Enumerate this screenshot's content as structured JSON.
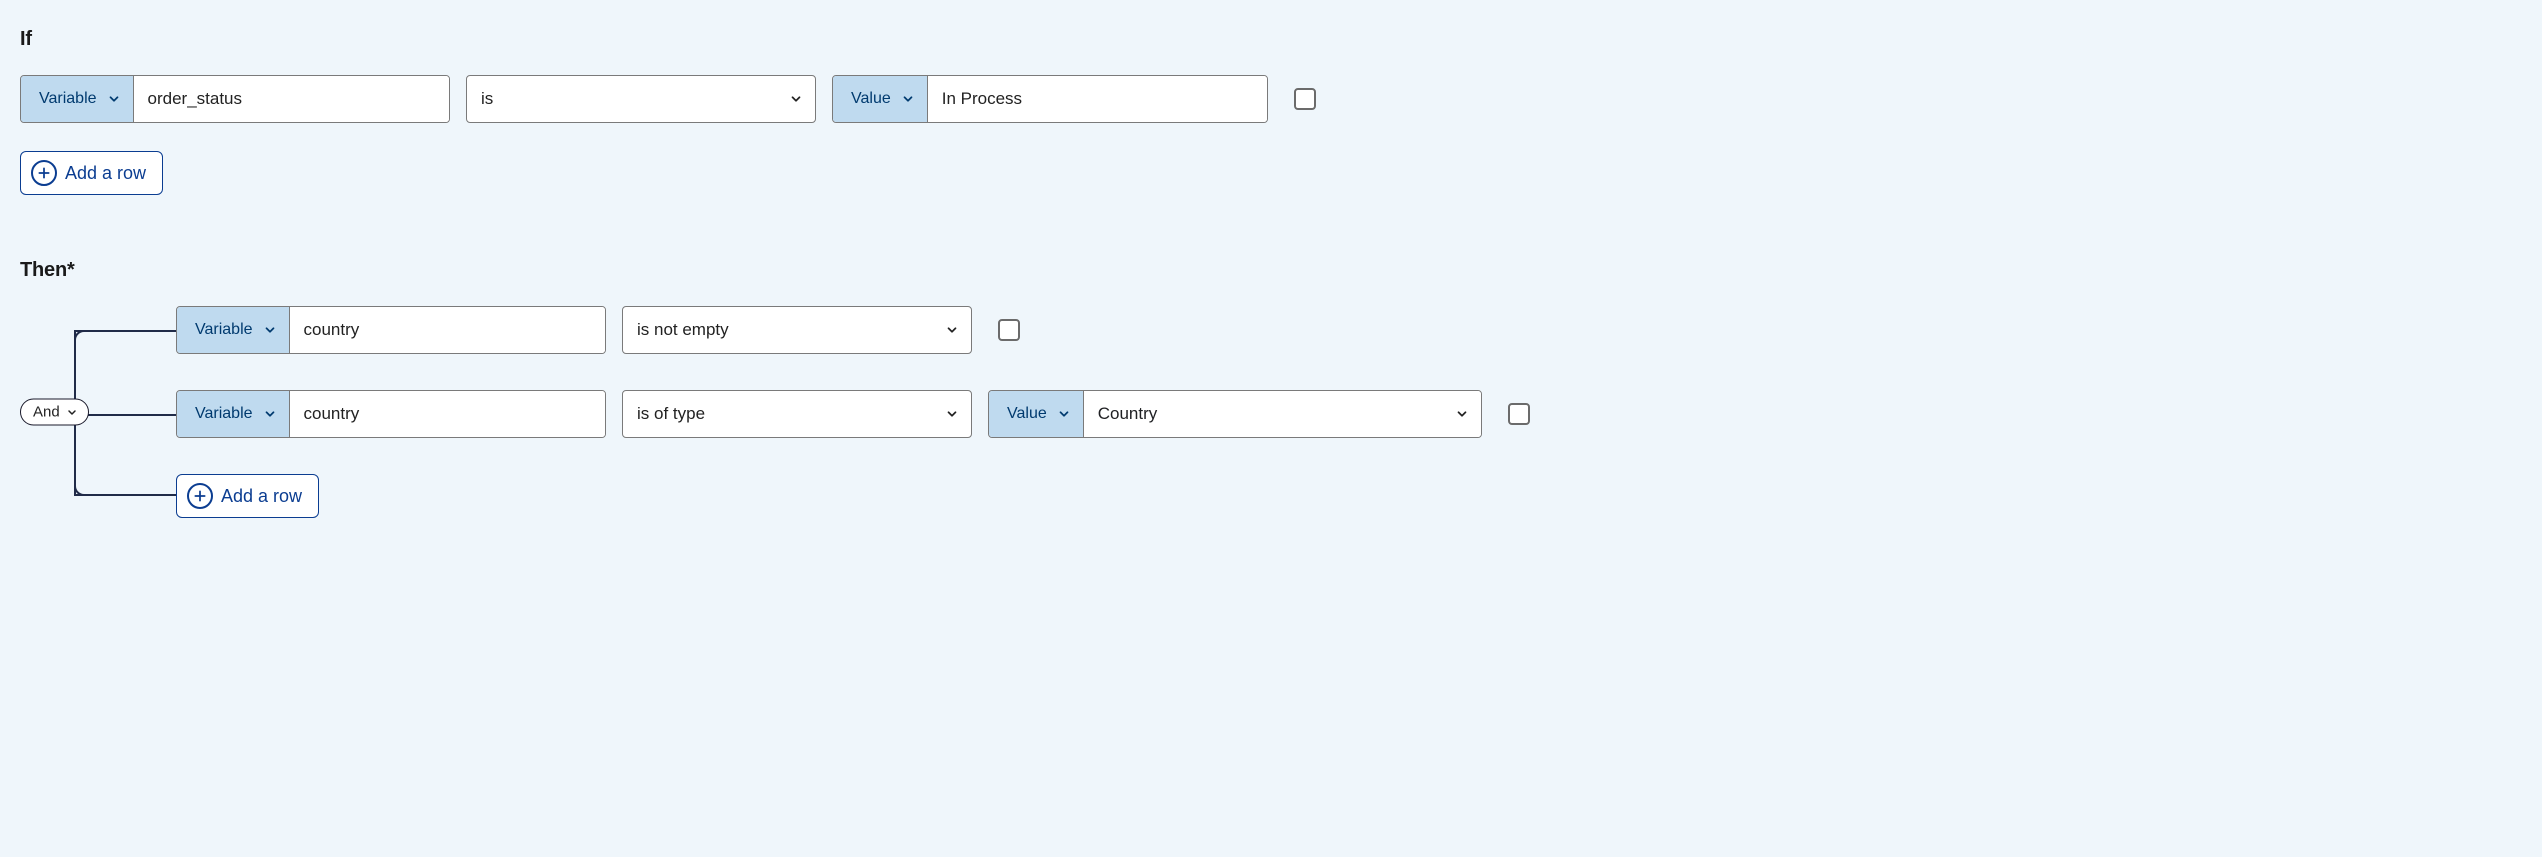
{
  "if": {
    "heading": "If",
    "row": {
      "type_label": "Variable",
      "variable": "order_status",
      "operator": "is",
      "value_type_label": "Value",
      "value": "In Process"
    },
    "add_row_label": "Add a row"
  },
  "then": {
    "heading": "Then*",
    "logic": "And",
    "rows": [
      {
        "type_label": "Variable",
        "variable": "country",
        "operator": "is not empty"
      },
      {
        "type_label": "Variable",
        "variable": "country",
        "operator": "is of type",
        "value_type_label": "Value",
        "value": "Country"
      }
    ],
    "add_row_label": "Add a row"
  }
}
